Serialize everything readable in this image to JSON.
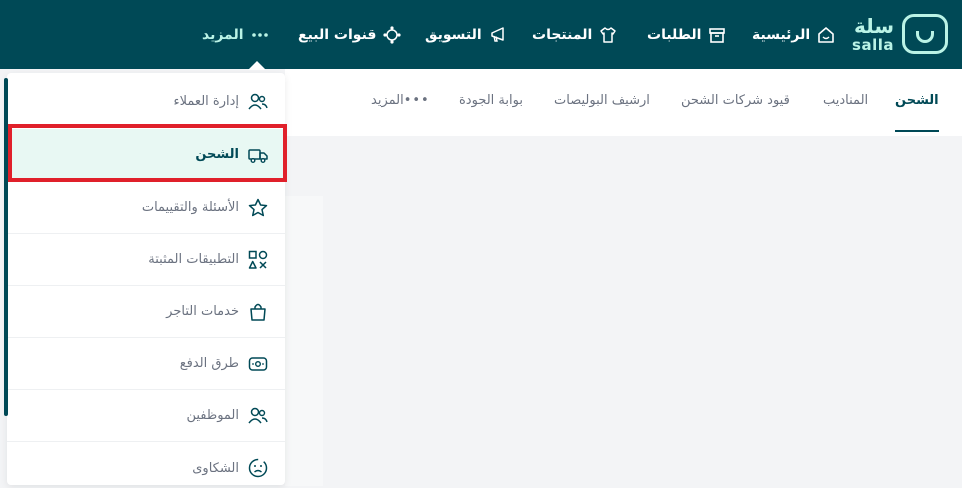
{
  "brand": {
    "arabic": "سلة",
    "latin": "salla"
  },
  "nav": {
    "home": "الرئيسية",
    "orders": "الطلبات",
    "products": "المنتجات",
    "marketing": "التسويق",
    "channels": "قنوات البيع",
    "more": "المزيد"
  },
  "tabs": {
    "shipping": "الشحن",
    "reps": "المناديب",
    "restrictions": "قيود شركات الشحن",
    "archive": "ارشيف البوليصات",
    "quality": "بوابة الجودة",
    "more": "المزيد"
  },
  "menu": {
    "customers": "إدارة العملاء",
    "shipping": "الشحن",
    "reviews": "الأسئلة والتقييمات",
    "apps": "التطبيقات المثبتة",
    "services": "خدمات التاجر",
    "payment": "طرق الدفع",
    "employees": "الموظفين",
    "complaints": "الشكاوى"
  },
  "colors": {
    "navbar": "#004956",
    "accent": "#baf3e6",
    "selected_bg": "#e8f8f3",
    "highlight": "#e0202a"
  }
}
